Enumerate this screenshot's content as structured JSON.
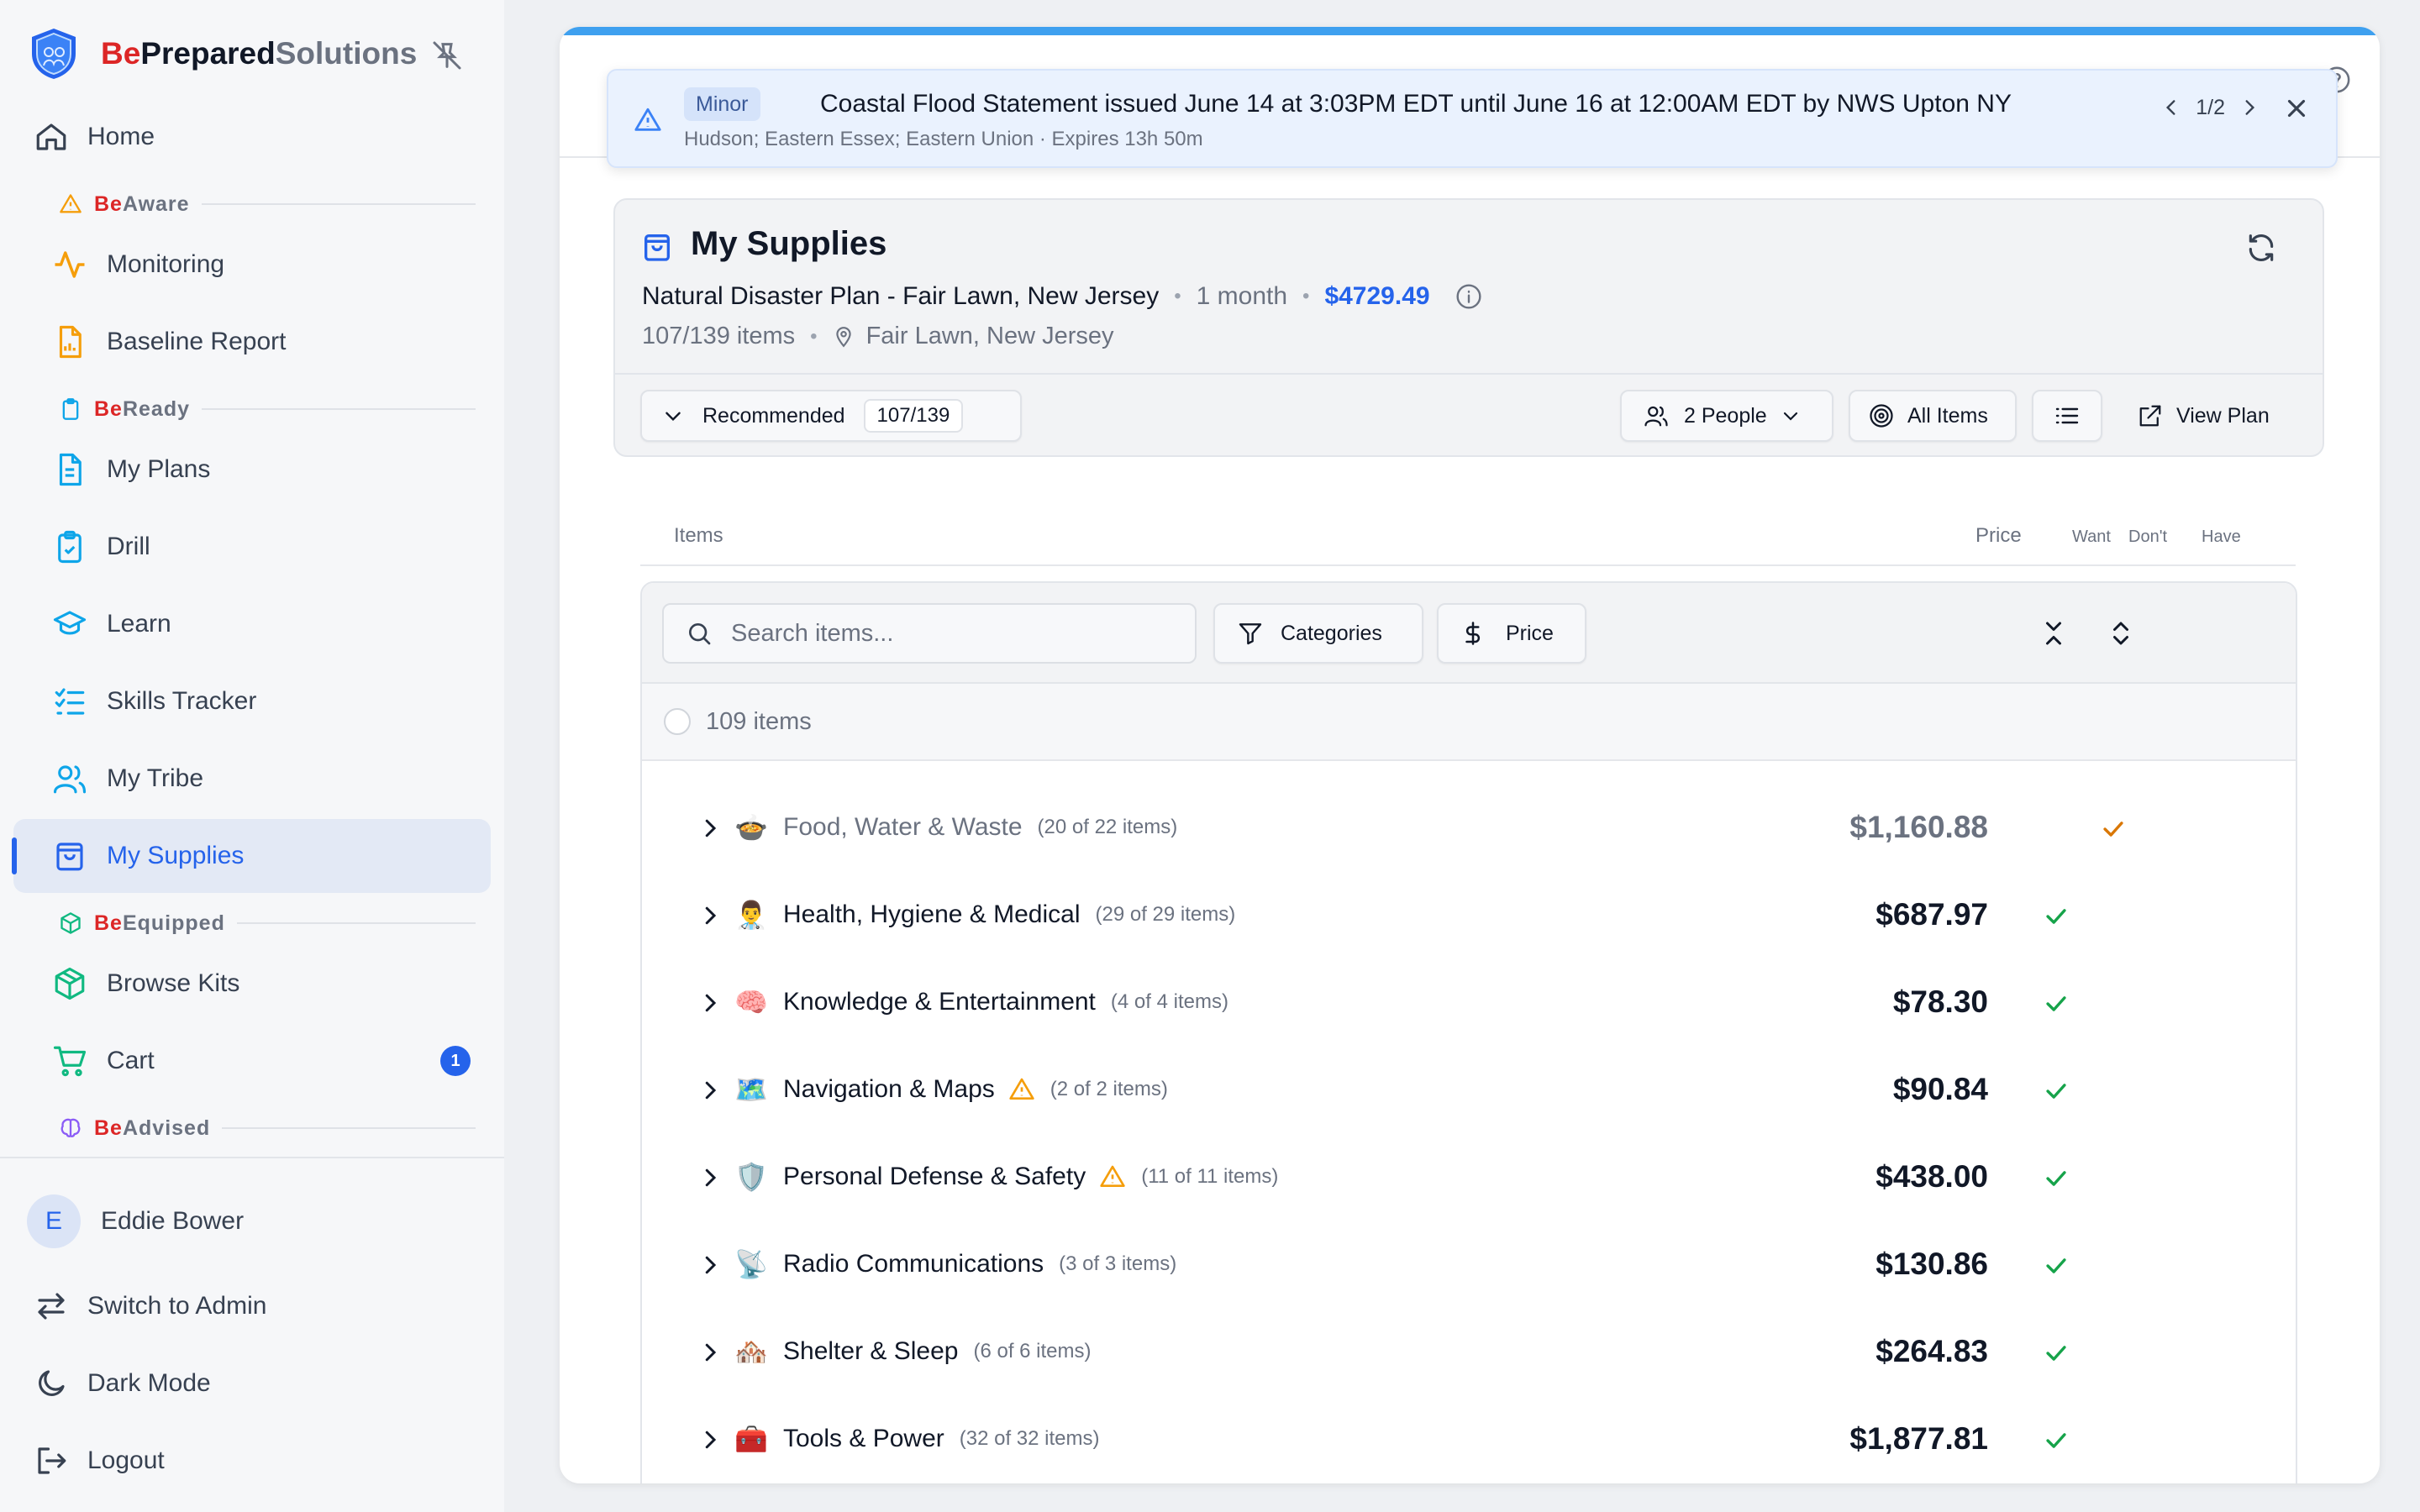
{
  "brand": {
    "part1": "Be",
    "part2": "Prepared",
    "part3": "Solutions"
  },
  "nav": {
    "home": "Home",
    "sections": {
      "aware": {
        "be": "Be",
        "rest": "Aware"
      },
      "ready": {
        "be": "Be",
        "rest": "Ready"
      },
      "equipped": {
        "be": "Be",
        "rest": "Equipped"
      },
      "advised": {
        "be": "Be",
        "rest": "Advised"
      }
    },
    "monitoring": "Monitoring",
    "baseline": "Baseline Report",
    "plans": "My Plans",
    "drill": "Drill",
    "learn": "Learn",
    "skills": "Skills Tracker",
    "tribe": "My Tribe",
    "supplies": "My Supplies",
    "kits": "Browse Kits",
    "cart": "Cart",
    "cart_count": "1"
  },
  "user": {
    "initial": "E",
    "name": "Eddie Bower"
  },
  "footer": {
    "admin": "Switch to Admin",
    "dark": "Dark Mode",
    "logout": "Logout"
  },
  "alert": {
    "severity": "Minor",
    "title": "Coastal Flood Statement issued June 14 at 3:03PM EDT until June 16 at 12:00AM EDT by NWS Upton NY",
    "subtitle": "Hudson; Eastern Essex; Eastern Union · Expires 13h 50m",
    "pager": "1/2"
  },
  "supplies": {
    "title": "My Supplies",
    "plan_name": "Natural Disaster Plan - Fair Lawn, New Jersey",
    "duration": "1 month",
    "total_cost": "$4729.49",
    "item_progress": "107/139 items",
    "location": "Fair Lawn, New Jersey",
    "recommended_label": "Recommended",
    "recommended_count": "107/139",
    "people_label": "2 People",
    "all_items_label": "All Items",
    "view_plan_label": "View Plan"
  },
  "columns": {
    "items": "Items",
    "price": "Price",
    "want": "Want",
    "dont": "Don't",
    "have": "Have"
  },
  "toolbar": {
    "search_placeholder": "Search items...",
    "categories": "Categories",
    "price": "Price"
  },
  "item_count": "109 items",
  "categories": [
    {
      "emoji": "🍲",
      "name": "Food, Water & Waste",
      "count": "(20 of 22 items)",
      "price": "$1,160.88",
      "warn": false,
      "state": "dont"
    },
    {
      "emoji": "👨‍⚕️",
      "name": "Health, Hygiene & Medical",
      "count": "(29 of 29 items)",
      "price": "$687.97",
      "warn": false,
      "state": "want"
    },
    {
      "emoji": "🧠",
      "name": "Knowledge & Entertainment",
      "count": "(4 of 4 items)",
      "price": "$78.30",
      "warn": false,
      "state": "want"
    },
    {
      "emoji": "🗺️",
      "name": "Navigation & Maps",
      "count": "(2 of 2 items)",
      "price": "$90.84",
      "warn": true,
      "state": "want"
    },
    {
      "emoji": "🛡️",
      "name": "Personal Defense & Safety",
      "count": "(11 of 11 items)",
      "price": "$438.00",
      "warn": true,
      "state": "want"
    },
    {
      "emoji": "📡",
      "name": "Radio Communications",
      "count": "(3 of 3 items)",
      "price": "$130.86",
      "warn": false,
      "state": "want"
    },
    {
      "emoji": "🏘️",
      "name": "Shelter & Sleep",
      "count": "(6 of 6 items)",
      "price": "$264.83",
      "warn": false,
      "state": "want"
    },
    {
      "emoji": "🧰",
      "name": "Tools & Power",
      "count": "(32 of 32 items)",
      "price": "$1,877.81",
      "warn": false,
      "state": "want"
    }
  ]
}
